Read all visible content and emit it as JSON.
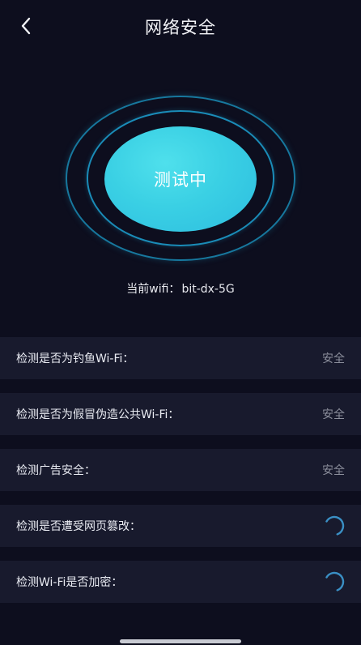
{
  "header": {
    "title": "网络安全",
    "back_icon": "chevron-left-icon"
  },
  "tester": {
    "status_label": "测试中",
    "wifi_prefix": "当前wifi：",
    "wifi_name": "bit-dx-5G"
  },
  "checks": [
    {
      "label": "检测是否为钓鱼Wi-Fi：",
      "state": "done",
      "result": "安全"
    },
    {
      "label": "检测是否为假冒伪造公共Wi-Fi：",
      "state": "done",
      "result": "安全"
    },
    {
      "label": "检测广告安全：",
      "state": "done",
      "result": "安全"
    },
    {
      "label": "检测是否遭受网页篡改：",
      "state": "loading",
      "result": ""
    },
    {
      "label": "检测Wi-Fi是否加密：",
      "state": "loading",
      "result": ""
    }
  ],
  "colors": {
    "background": "#0d0e1e",
    "row_background": "#181a2d",
    "accent": "#3ad0e4",
    "ring": "#1a8cb8",
    "status_text": "#8c8f9c"
  }
}
